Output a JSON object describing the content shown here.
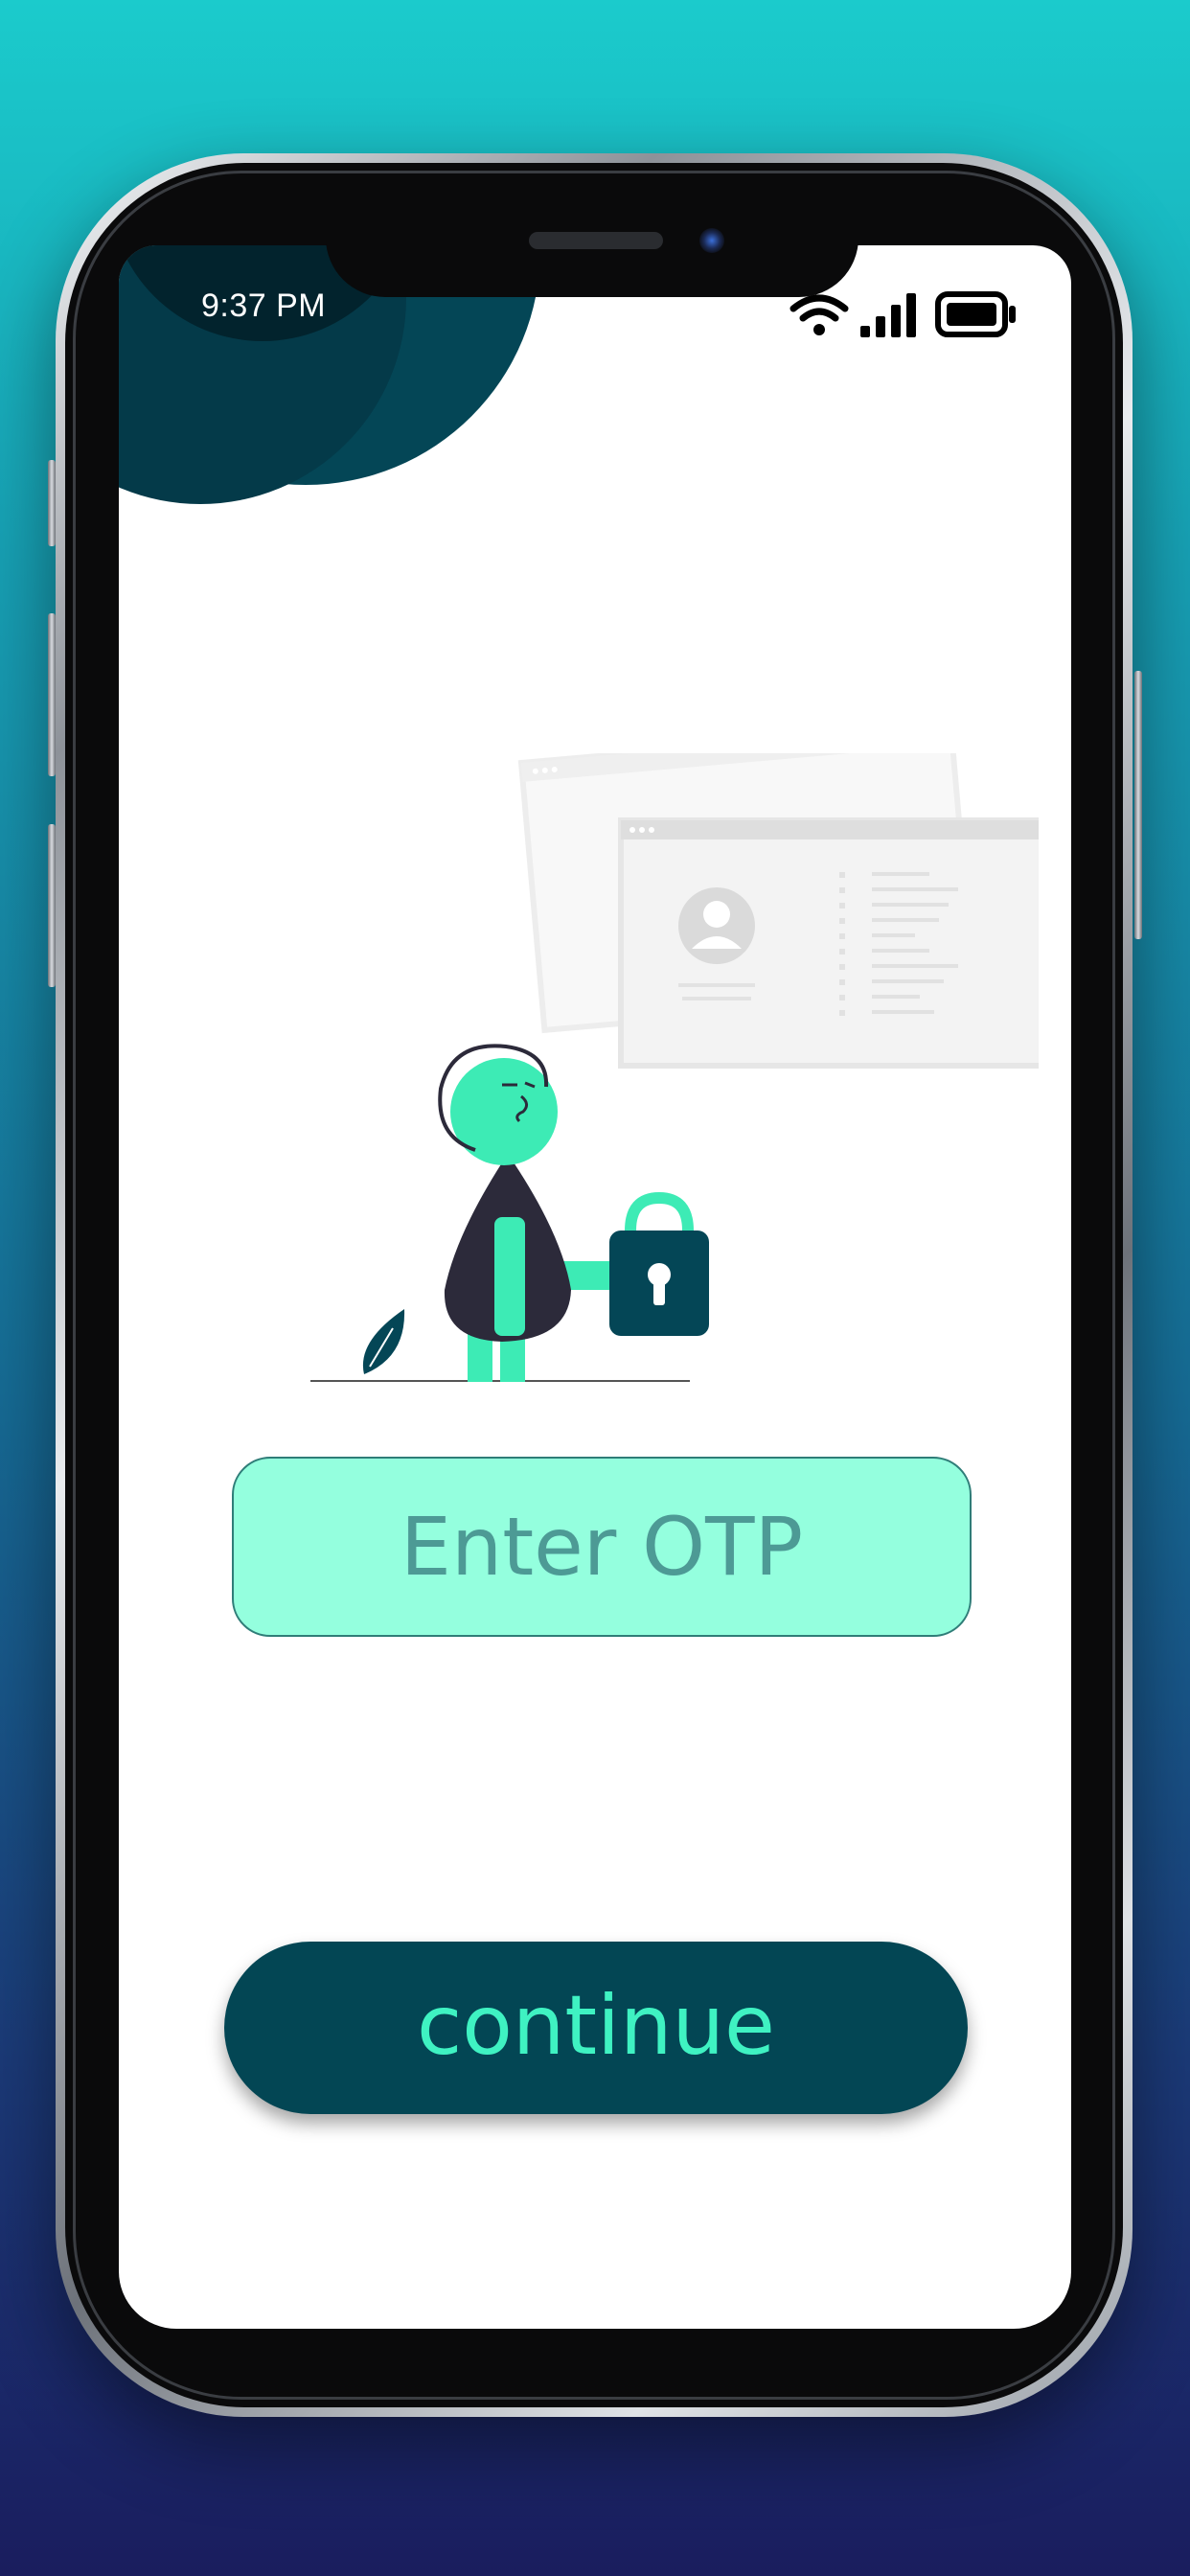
{
  "status_bar": {
    "time": "9:37 PM",
    "icons": [
      "wifi-icon",
      "cellular-signal-icon",
      "battery-icon"
    ]
  },
  "illustration": {
    "subject": "person-holding-padlock",
    "elements": [
      "person-figure",
      "padlock-icon",
      "browser-window",
      "profile-window",
      "leaf",
      "ground-line"
    ]
  },
  "otp_input": {
    "placeholder": "Enter OTP",
    "value": ""
  },
  "continue_button": {
    "label": "continue"
  },
  "colors": {
    "background_top": "#1bcbcc",
    "background_bottom": "#1a1d5e",
    "dark_teal": "#034654",
    "mint": "#94ffde",
    "accent_green": "#3ff2c2",
    "figure_green": "#3debb5",
    "figure_dark": "#2c2a3a"
  }
}
